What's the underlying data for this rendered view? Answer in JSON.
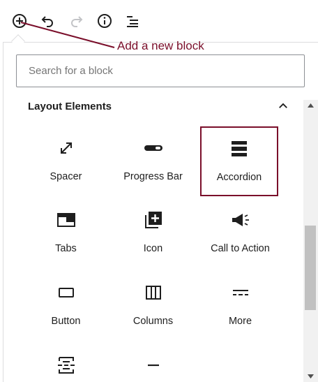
{
  "toolbar": {
    "buttons": [
      {
        "name": "add-block-icon"
      },
      {
        "name": "undo-icon"
      },
      {
        "name": "redo-icon"
      },
      {
        "name": "info-icon"
      },
      {
        "name": "list-view-icon"
      }
    ]
  },
  "annotation": {
    "text": "Add a new block",
    "color": "#7a0e2a"
  },
  "search": {
    "placeholder": "Search for a block",
    "value": ""
  },
  "panel": {
    "title": "Layout Elements",
    "toggle_icon": "chevron-up-icon"
  },
  "blocks": [
    {
      "label": "Spacer",
      "icon": "spacer-icon"
    },
    {
      "label": "Progress Bar",
      "icon": "progress-bar-icon"
    },
    {
      "label": "Accordion",
      "icon": "accordion-icon",
      "highlighted": true
    },
    {
      "label": "Tabs",
      "icon": "tabs-icon"
    },
    {
      "label": "Icon",
      "icon": "plus-square-icon"
    },
    {
      "label": "Call to Action",
      "icon": "megaphone-icon"
    },
    {
      "label": "Button",
      "icon": "button-icon"
    },
    {
      "label": "Columns",
      "icon": "columns-icon"
    },
    {
      "label": "More",
      "icon": "more-icon"
    },
    {
      "label": "",
      "icon": "page-break-icon"
    },
    {
      "label": "",
      "icon": "separator-icon"
    }
  ],
  "colors": {
    "accent": "#7a0e2a",
    "text": "#1e1e1e",
    "border": "#8c8f94"
  }
}
